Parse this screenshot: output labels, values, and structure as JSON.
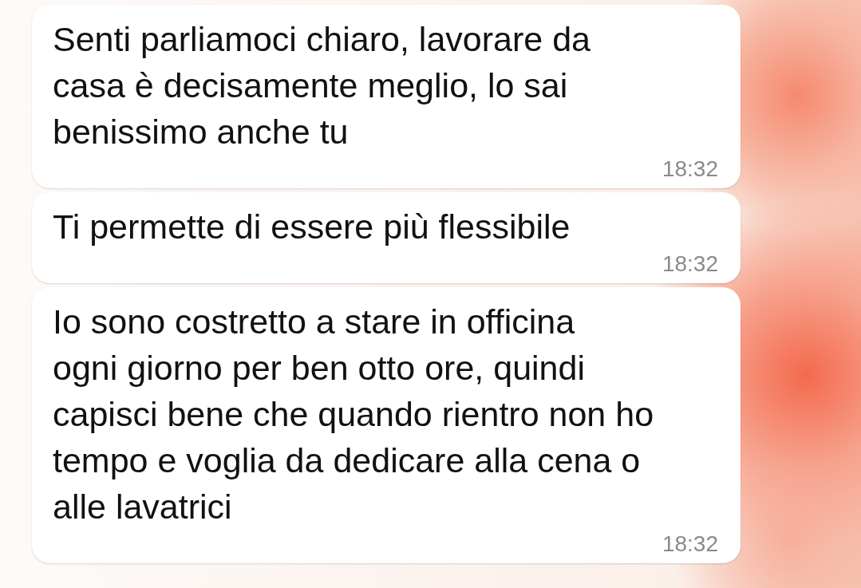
{
  "messages": [
    {
      "text": "Senti parliamoci chiaro, lavorare da\ncasa è decisamente meglio, lo sai\nbenissimo anche tu",
      "time": "18:32"
    },
    {
      "text": "Ti permette di essere più flessibile",
      "time": "18:32"
    },
    {
      "text": "Io sono costretto a stare in officina\nogni giorno per ben otto ore, quindi\ncapisci bene che quando rientro non ho\ntempo e voglia da dedicare alla cena o\nalle lavatrici",
      "time": "18:32"
    }
  ]
}
